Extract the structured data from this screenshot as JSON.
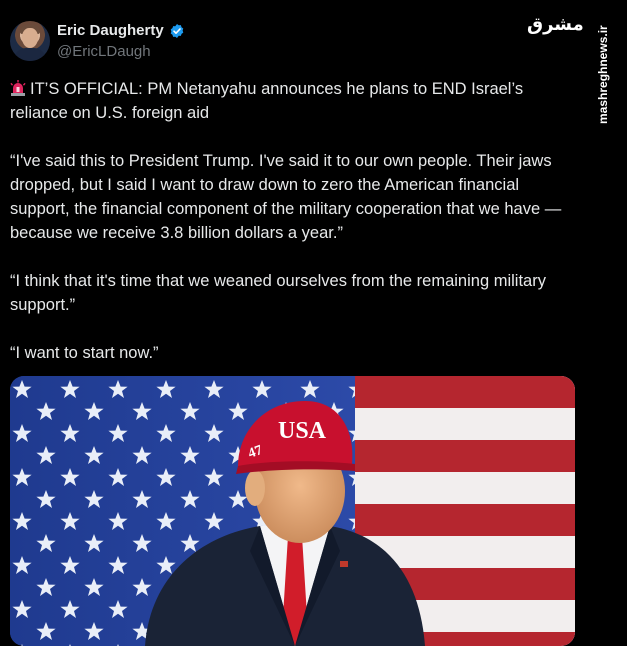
{
  "author": {
    "display_name": "Eric Daugherty",
    "handle": "@EricLDaugh",
    "verified": true,
    "avatar_icon": "profile-photo"
  },
  "watermark": {
    "logo_text": "مشرق",
    "site": "mashreghnews.ir"
  },
  "tweet": {
    "headline": "IT’S OFFICIAL: PM Netanyahu announces he plans to END Israel’s reliance on U.S. foreign aid",
    "headline_icon": "rotating-light-emoji",
    "quote_1": "“I've said this to President Trump. I've said it to our own people. Their jaws dropped, but I said I want to draw down to zero the American financial support, the financial component of the military cooperation that we have — because we receive 3.8 billion dollars a year.”",
    "quote_2": "“I think that it's time that we weaned ourselves from the remaining military support.”",
    "quote_3": "“I want to start now.”"
  },
  "media": {
    "hat_text": "USA",
    "hat_side_text": "47"
  },
  "colors": {
    "background": "#000000",
    "text": "#e7e9ea",
    "secondary_text": "#71767b",
    "verified_blue": "#1d9bf0"
  }
}
